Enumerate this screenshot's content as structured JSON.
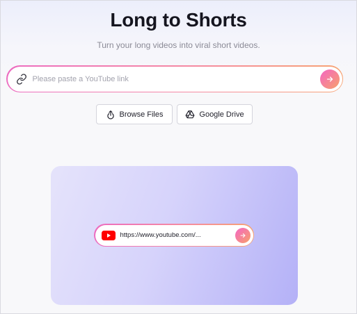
{
  "header": {
    "title": "Long to Shorts",
    "subtitle": "Turn your long videos into viral short videos."
  },
  "search": {
    "placeholder": "Please paste a YouTube link",
    "value": "",
    "link_icon": "link-icon",
    "submit_icon": "arrow-right-icon"
  },
  "actions": {
    "browse_label": "Browse Files",
    "browse_icon": "upload-icon",
    "drive_label": "Google Drive",
    "drive_icon": "google-drive-icon"
  },
  "preview": {
    "url_text": "https://www.youtube.com/...",
    "source_icon": "youtube-icon",
    "submit_icon": "arrow-right-icon"
  },
  "colors": {
    "accent_start": "#f466c4",
    "accent_end": "#f7a06a",
    "youtube_red": "#ff0000",
    "preview_bg": "#c9c6fa"
  }
}
